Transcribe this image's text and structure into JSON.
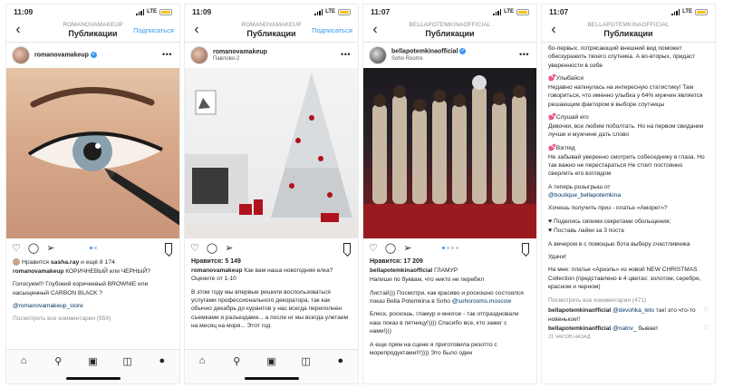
{
  "colors": {
    "accent": "#3897f0",
    "battery": "#f2c218",
    "link": "#003569",
    "muted": "#8e8e8e"
  },
  "icons": {
    "back": "chevron-left-icon",
    "more": "more-dots-icon",
    "like": "heart-icon",
    "comment": "comment-icon",
    "share": "paper-plane-icon",
    "save": "bookmark-icon",
    "home": "home-icon",
    "search": "search-icon",
    "reels": "reels-icon",
    "shop": "shop-icon"
  },
  "panels": [
    {
      "status_time": "11:09",
      "status_network": "LTE",
      "nav_user": "ROMANOVAMAKEUP",
      "nav_title": "Публикации",
      "nav_follow": "Подписаться",
      "post_user": "romanovamakeup",
      "post_location": "",
      "liked_by_prefix": "Нравится",
      "liked_by_user": "sasha.ray",
      "liked_by_suffix": "и ещё 8 174",
      "caption_user": "romanovamakeup",
      "caption_1": "КОРИЧНЕВЫЙ или ЧЕРНЫЙ?",
      "caption_2": "Голосуем!!! Глубокий коричневый BROWNIE или насыщенный CARBON BLACK ?",
      "caption_link": "@romanovamakeup_store",
      "view_comments": "Посмотреть все комментарии (559)"
    },
    {
      "status_time": "11:09",
      "status_network": "LTE",
      "nav_user": "ROMANOVAMAKEUP",
      "nav_title": "Публикации",
      "nav_follow": "Подписаться",
      "post_user": "romanovamakeup",
      "post_location": "Павлово-2",
      "likes": "Нравится: 5 149",
      "caption_user": "romanovamakeup",
      "caption_1": "Как вам наша новогодняя елка? Оцените от 1-10",
      "caption_2": "В этом году мы впервые решили воспользоваться услугами профессионального декоратора, так как обычно декабрь до курантов у нас всегда переполнен съемками и разъездами... а после нг мы всегда улетаем на месяц на моря... Этот год"
    },
    {
      "status_time": "11:07",
      "status_network": "LTE",
      "nav_user": "BELLAPOTEMKINAOFFICIAL",
      "nav_title": "Публикации",
      "post_user": "bellapotemkinaofficial",
      "post_location": "Soho Rooms",
      "likes": "Нравится: 17 209",
      "caption_user": "bellapotemkinaofficial",
      "caption_1": "ГЛАМУР",
      "caption_2": "Напиши по буквам, что никто не перебил",
      "caption_3": "Листай))) Посмотри, как красиво и роскошно состоялся показ Bella Potemkina в Soho",
      "caption_link": "@sohorooms.moscow",
      "caption_4": "Блеск, роскошь, гламур и многое - так отпраздновали наш показ в пятницу!)))) Спасибо все, кто зажег с нами!)))",
      "caption_5": "А еще прям на сцене я приготовила ризотто с морепродуктами!!!)))) Это было один"
    },
    {
      "status_time": "11:07",
      "status_network": "LTE",
      "nav_user": "BELLAPOTEMKINAOFFICIAL",
      "nav_title": "Публикации",
      "text_1": "бо-первых, потрясающий внешний вид поможет обескуражить твоего спутника. А во-вторых, придаст уверенности в себе",
      "text_2_head": "Улыбайся",
      "text_2": "Недавно наткнулась на интересную статистику! Там говориться, что именно улыбка у 64% мужчин является решающим фактором в выборе спутницы",
      "text_3_head": "Слушай его",
      "text_3": "Девочки, все любим поболтать. Но на первом свидании лучше и мужчине дать слово",
      "text_4_head": "Взгляд",
      "text_4": "Не забывай уверенно смотреть собеседнику в глаза. Но так важно не перестараться Не стоит постоянно сверлить его взглядом",
      "text_5": "А теперь розыгрыш от",
      "text_5_link": "@boutique_bellapotemkina",
      "text_6": "Хочешь получить приз - платье «Аморет»?",
      "text_7a": "Поделись своими секретами обольщения;",
      "text_7b": "Поставь лайки за 3 поста",
      "text_8": "А вечером в с помощью бота выберу счастливчика",
      "text_9": "Удачи!",
      "text_10": "На мне: платье «Ариэль» из новой NEW CHRISTMAS Collection (представлено в 4 цветах: золотом, серебре, красном и черном)",
      "view_comments": "Посмотреть все комментарии (471)",
      "c1_user": "bellapotemkinaofficial",
      "c1_link": "@devohka_leto",
      "c1_text": "так! это что-то новенькое!!",
      "c2_user": "bellapotemkinaofficial",
      "c2_link": "@natnv_",
      "c2_text": "бывает",
      "time_ago": "21 ЧАСОВ НАЗАД"
    }
  ]
}
